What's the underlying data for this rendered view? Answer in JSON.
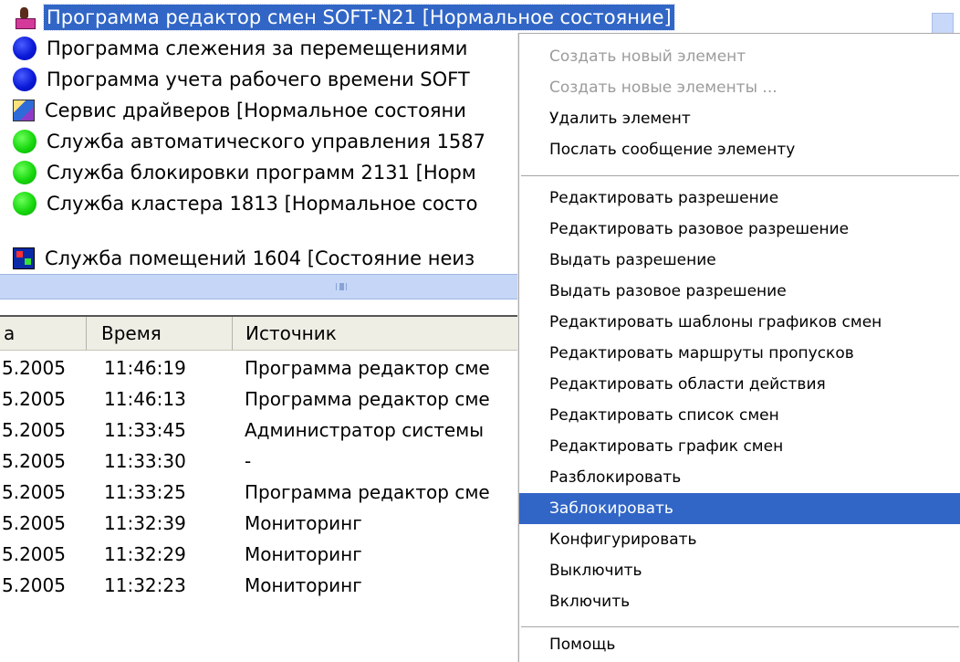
{
  "tree": {
    "items": [
      {
        "label": "Программа редактор смен SOFT-N21 [Нормальное состояние]",
        "icon": "user-program-icon"
      },
      {
        "label": "Программа слежения за перемещениями",
        "icon": "blue-status-icon"
      },
      {
        "label": "Программа учета рабочего времени SOFT",
        "icon": "blue-status-icon"
      },
      {
        "label": "Сервис драйверов [Нормальное состояни",
        "icon": "drivers-service-icon"
      },
      {
        "label": "Служба автоматического управления 1587",
        "icon": "green-status-icon"
      },
      {
        "label": "Служба блокировки программ 2131 [Норм",
        "icon": "green-status-icon"
      },
      {
        "label": "Служба кластера 1813 [Нормальное состо",
        "icon": "green-status-icon"
      },
      {
        "label": "Служба помещений 1604 [Состояние неиз",
        "icon": "rooms-service-icon"
      }
    ]
  },
  "splitter": {
    "grip_icon": "splitter-grip-icon"
  },
  "events": {
    "columns": [
      "а",
      "Время",
      "Источник"
    ],
    "rows": [
      {
        "date": "5.2005",
        "time": "11:46:19",
        "source": "Программа редактор сме"
      },
      {
        "date": "5.2005",
        "time": "11:46:13",
        "source": "Программа редактор сме"
      },
      {
        "date": "5.2005",
        "time": "11:33:45",
        "source": "Администратор системы"
      },
      {
        "date": "5.2005",
        "time": "11:33:30",
        "source": "-"
      },
      {
        "date": "5.2005",
        "time": "11:33:25",
        "source": "Программа редактор сме"
      },
      {
        "date": "5.2005",
        "time": "11:32:39",
        "source": "Мониторинг"
      },
      {
        "date": "5.2005",
        "time": "11:32:29",
        "source": "Мониторинг"
      },
      {
        "date": "5.2005",
        "time": "11:32:23",
        "source": "Мониторинг"
      }
    ]
  },
  "menu": {
    "items": [
      {
        "label": "Создать новый элемент",
        "enabled": false
      },
      {
        "label": "Создать новые элементы ...",
        "enabled": false
      },
      {
        "label": "Удалить элемент",
        "enabled": true
      },
      {
        "label": "Послать сообщение элементу",
        "enabled": true
      },
      {
        "label": "Редактировать разрешение",
        "enabled": true
      },
      {
        "label": "Редактировать разовое разрешение",
        "enabled": true
      },
      {
        "label": "Выдать разрешение",
        "enabled": true
      },
      {
        "label": "Выдать разовое разрешение",
        "enabled": true
      },
      {
        "label": "Редактировать шаблоны графиков смен",
        "enabled": true
      },
      {
        "label": "Редактировать маршруты пропусков",
        "enabled": true
      },
      {
        "label": "Редактировать области действия",
        "enabled": true
      },
      {
        "label": "Редактировать список смен",
        "enabled": true
      },
      {
        "label": "Редактировать график смен",
        "enabled": true
      },
      {
        "label": "Разблокировать",
        "enabled": true
      },
      {
        "label": "Заблокировать",
        "enabled": true,
        "highlighted": true
      },
      {
        "label": "Конфигурировать",
        "enabled": true
      },
      {
        "label": "Выключить",
        "enabled": true
      },
      {
        "label": "Включить",
        "enabled": true
      },
      {
        "label": "Помощь",
        "enabled": true
      }
    ]
  },
  "colors": {
    "selection": "#3166c6",
    "disabled_text": "#9c9c9c",
    "splitter": "#c5d6f6"
  }
}
